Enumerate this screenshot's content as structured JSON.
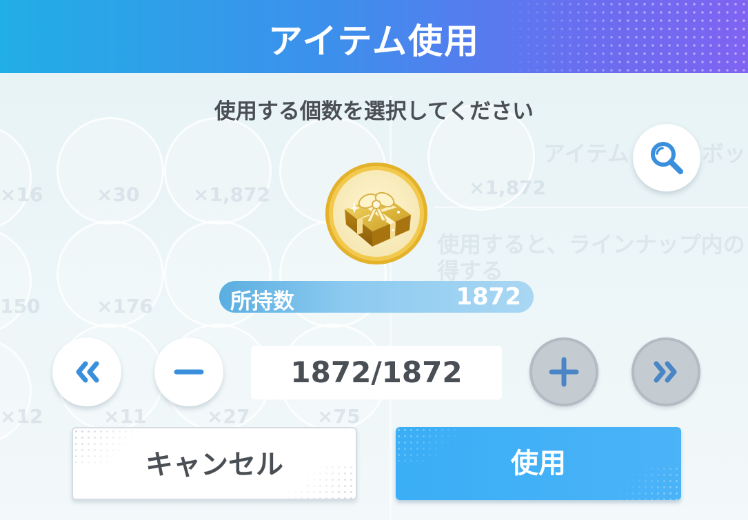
{
  "header": {
    "title": "アイテム使用"
  },
  "dialog": {
    "subtitle": "使用する個数を選択してください",
    "item": {
      "icon": "gold-gift-box-icon",
      "owned_label": "所持数",
      "owned_count": "1872"
    },
    "quantity": {
      "display": "1872/1872",
      "selected": 1872,
      "max": 1872
    },
    "controls": {
      "min_icon": "double-chevron-left-icon",
      "decrement_icon": "minus-icon",
      "increment_icon": "plus-icon",
      "max_icon": "double-chevron-right-icon",
      "zoom_icon": "magnifier-icon"
    },
    "buttons": {
      "cancel_label": "キャンセル",
      "use_label": "使用"
    }
  },
  "background": {
    "counts": [
      "×16",
      "×30",
      "×1,872",
      "×1,872",
      "150",
      "×176",
      "×12",
      "×11",
      "×27",
      "×75"
    ],
    "detail_title": "アイテム",
    "detail_title_suffix": "ボッ",
    "detail_desc_line1": "使用すると、ラインナップ内の",
    "detail_desc_line2": "得する"
  },
  "colors": {
    "header_start": "#22aee6",
    "header_end": "#7f63f2",
    "accent_blue": "#4bb3f8",
    "control_blue": "#3a8fdc",
    "text_dark": "#4a4f55"
  }
}
